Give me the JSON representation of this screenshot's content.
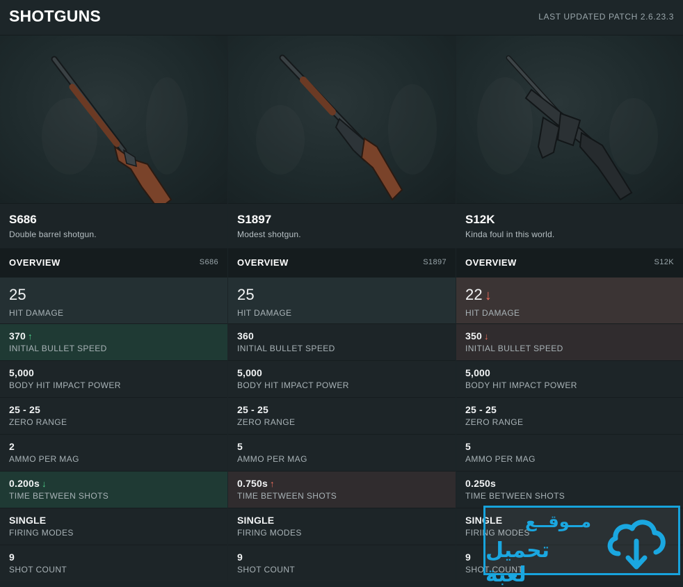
{
  "header": {
    "title": "SHOTGUNS",
    "patch": "LAST UPDATED PATCH 2.6.23.3"
  },
  "watermark": {
    "line1": "مــوقــع",
    "line2": "تحميل لعبة",
    "icon": "cloud-download-icon",
    "color": "#1aa7e0"
  },
  "colors": {
    "better": "#4fd18a",
    "worse": "#ee6e5d",
    "better_bg": "#1f3a34",
    "worse_bg": "#302c2e"
  },
  "weapons": [
    {
      "name": "S686",
      "description": "Double barrel shotgun.",
      "overview_label": "OVERVIEW",
      "code": "S686",
      "stats": [
        {
          "value": "25",
          "label": "HIT DAMAGE",
          "trend": ""
        },
        {
          "value": "370",
          "label": "INITIAL BULLET SPEED",
          "trend": "up-better"
        },
        {
          "value": "5,000",
          "label": "BODY HIT IMPACT POWER",
          "trend": ""
        },
        {
          "value": "25 - 25",
          "label": "ZERO RANGE",
          "trend": ""
        },
        {
          "value": "2",
          "label": "AMMO PER MAG",
          "trend": ""
        },
        {
          "value": "0.200s",
          "label": "TIME BETWEEN SHOTS",
          "trend": "down-better"
        },
        {
          "value": "SINGLE",
          "label": "FIRING MODES",
          "trend": ""
        },
        {
          "value": "9",
          "label": "SHOT COUNT",
          "trend": ""
        }
      ]
    },
    {
      "name": "S1897",
      "description": "Modest shotgun.",
      "overview_label": "OVERVIEW",
      "code": "S1897",
      "stats": [
        {
          "value": "25",
          "label": "HIT DAMAGE",
          "trend": ""
        },
        {
          "value": "360",
          "label": "INITIAL BULLET SPEED",
          "trend": ""
        },
        {
          "value": "5,000",
          "label": "BODY HIT IMPACT POWER",
          "trend": ""
        },
        {
          "value": "25 - 25",
          "label": "ZERO RANGE",
          "trend": ""
        },
        {
          "value": "5",
          "label": "AMMO PER MAG",
          "trend": ""
        },
        {
          "value": "0.750s",
          "label": "TIME BETWEEN SHOTS",
          "trend": "up-worse"
        },
        {
          "value": "SINGLE",
          "label": "FIRING MODES",
          "trend": ""
        },
        {
          "value": "9",
          "label": "SHOT COUNT",
          "trend": ""
        }
      ]
    },
    {
      "name": "S12K",
      "description": "Kinda foul in this world.",
      "overview_label": "OVERVIEW",
      "code": "S12K",
      "stats": [
        {
          "value": "22",
          "label": "HIT DAMAGE",
          "trend": "down-worse"
        },
        {
          "value": "350",
          "label": "INITIAL BULLET SPEED",
          "trend": "down-worse"
        },
        {
          "value": "5,000",
          "label": "BODY HIT IMPACT POWER",
          "trend": ""
        },
        {
          "value": "25 - 25",
          "label": "ZERO RANGE",
          "trend": ""
        },
        {
          "value": "5",
          "label": "AMMO PER MAG",
          "trend": ""
        },
        {
          "value": "0.250s",
          "label": "TIME BETWEEN SHOTS",
          "trend": ""
        },
        {
          "value": "SINGLE",
          "label": "FIRING MODES",
          "trend": ""
        },
        {
          "value": "9",
          "label": "SHOT COUNT",
          "trend": ""
        }
      ]
    }
  ]
}
